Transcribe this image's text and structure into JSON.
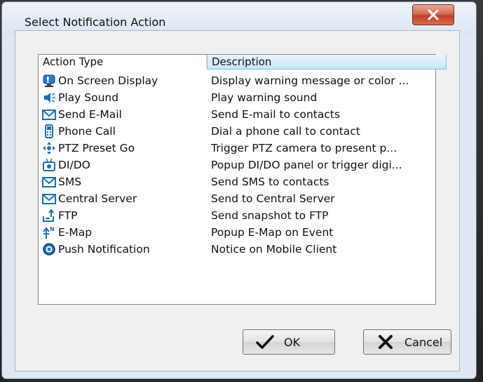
{
  "window": {
    "title": "Select Notification Action",
    "close_label": "X"
  },
  "list": {
    "columns": [
      "Action Type",
      "Description"
    ],
    "rows": [
      {
        "name": "On Screen Display",
        "description": "Display warning message or color ...",
        "icon": "monitor-icon"
      },
      {
        "name": "Play Sound",
        "description": "Play warning sound",
        "icon": "speaker-icon"
      },
      {
        "name": "Send E-Mail",
        "description": "Send E-mail to contacts",
        "icon": "envelope-icon"
      },
      {
        "name": "Phone Call",
        "description": "Dial a phone call to contact",
        "icon": "phone-icon"
      },
      {
        "name": "PTZ Preset Go",
        "description": "Trigger PTZ camera to present p...",
        "icon": "ptz-icon"
      },
      {
        "name": "DI/DO",
        "description": "Popup DI/DO panel or trigger digi...",
        "icon": "dido-icon"
      },
      {
        "name": "SMS",
        "description": "Send SMS to contacts",
        "icon": "envelope-icon"
      },
      {
        "name": "Central Server",
        "description": "Send to Central Server",
        "icon": "envelope-icon"
      },
      {
        "name": "FTP",
        "description": "Send snapshot to FTP",
        "icon": "ftp-upload-icon"
      },
      {
        "name": "E-Map",
        "description": "Popup E-Map on Event",
        "icon": "compass-icon"
      },
      {
        "name": "Push Notification",
        "description": "Notice on Mobile Client",
        "icon": "push-globe-icon"
      }
    ]
  },
  "buttons": {
    "ok_label": "OK",
    "cancel_label": "Cancel"
  },
  "colors": {
    "accent": "#84c0e4",
    "close_red": "#c04127",
    "icon_blue": "#1f6fb5"
  }
}
